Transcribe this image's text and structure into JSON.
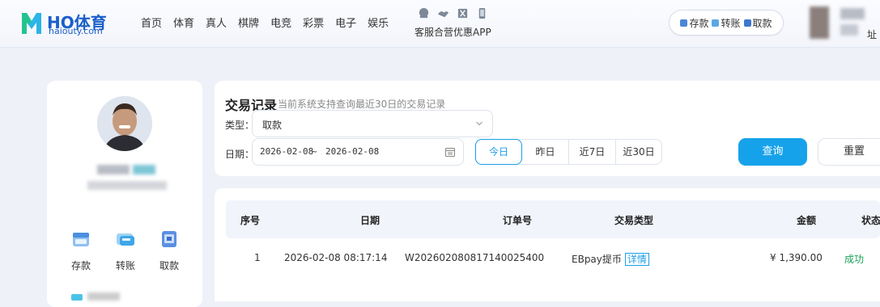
{
  "header": {
    "logo_name": "HO体育",
    "logo_domain": "haiouty.com",
    "nav": [
      "首页",
      "体育",
      "真人",
      "棋牌",
      "电竞",
      "彩票",
      "电子",
      "娱乐"
    ],
    "service_label": "客服合营优惠APP",
    "fund_actions": [
      {
        "label": "存款"
      },
      {
        "label": "转账"
      },
      {
        "label": "取款"
      }
    ],
    "user_tail": "址"
  },
  "profile": {
    "quick_actions": [
      {
        "label": "存款",
        "icon": "deposit-icon"
      },
      {
        "label": "转账",
        "icon": "transfer-icon"
      },
      {
        "label": "取款",
        "icon": "withdraw-icon"
      }
    ]
  },
  "filter": {
    "title": "交易记录",
    "subtitle": "当前系统支持查询最近30日的交易记录",
    "type_label": "类型：",
    "type_value": "取款",
    "date_label": "日期：",
    "date_start": "2026-02-08",
    "date_sep": "~",
    "date_end": "2026-02-08",
    "quick_ranges": [
      {
        "label": "今日",
        "active": true
      },
      {
        "label": "昨日",
        "active": false
      },
      {
        "label": "近7日",
        "active": false
      },
      {
        "label": "近30日",
        "active": false
      }
    ],
    "query_button": "查询",
    "reset_button": "重置"
  },
  "table": {
    "columns": [
      "序号",
      "日期",
      "订单号",
      "交易类型",
      "金额",
      "状态"
    ],
    "rows": [
      {
        "index": "1",
        "date": "2026-02-08 08:17:14",
        "order_no": "W20260208081714002540 0",
        "type": "EBpay提币",
        "detail": "详情",
        "amount": "¥ 1,390.00",
        "status": "成功"
      }
    ]
  },
  "colors": {
    "accent": "#16a2ea",
    "success": "#1aa05a",
    "brand": "#1a5fc8"
  }
}
